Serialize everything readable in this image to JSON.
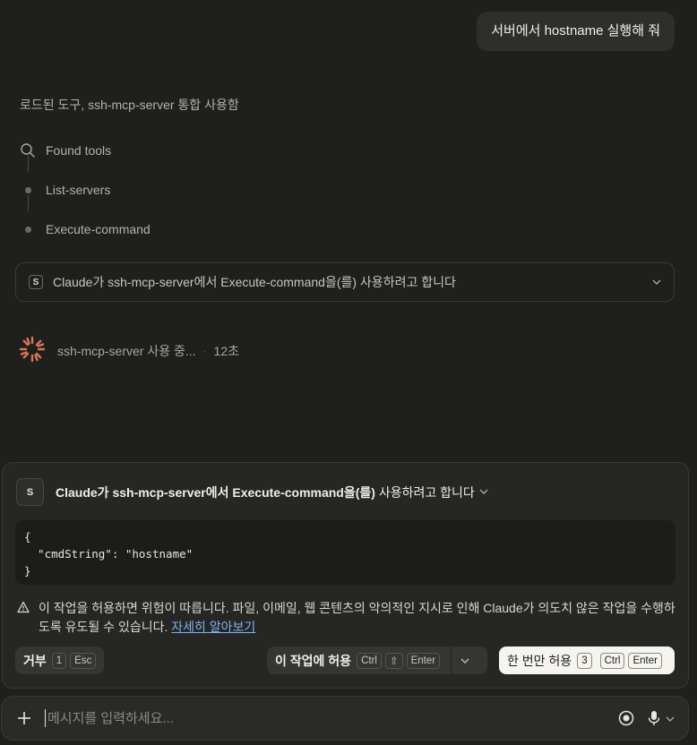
{
  "user_message": "서버에서 hostname 실행해 줘",
  "loaded_tools_text": "로드된 도구, ssh-mcp-server 통합 사용함",
  "steps": [
    {
      "label": "Found tools",
      "icon": "search-icon"
    },
    {
      "label": "List-servers",
      "icon": "dot-icon"
    },
    {
      "label": "Execute-command",
      "icon": "dot-icon"
    }
  ],
  "permission_collapsed": {
    "badge": "S",
    "text": "Claude가 ssh-mcp-server에서 Execute-command을(를) 사용하려고 합니다"
  },
  "working": {
    "label": "ssh-mcp-server 사용 중...",
    "separator": "·",
    "elapsed": "12초"
  },
  "permission_panel": {
    "badge": "S",
    "title_bold": "Claude가 ssh-mcp-server에서 Execute-command을(를)",
    "title_rest": " 사용하려고 합니다",
    "code": "{\n  \"cmdString\": \"hostname\"\n}",
    "warning_text": "이 작업을 허용하면 위험이 따릅니다. 파일, 이메일, 웹 콘텐츠의 악의적인 지시로 인해 Claude가 의도치 않은 작업을 수행하도록 유도될 수 있습니다. ",
    "learn_more": "자세히 알아보기",
    "deny": {
      "label": "거부",
      "key_num": "1",
      "key_esc": "Esc"
    },
    "allow_task": {
      "label": "이 작업에 허용",
      "key_ctrl": "Ctrl",
      "key_shift": "⇧",
      "key_enter": "Enter"
    },
    "allow_once": {
      "label": "한 번만 허용",
      "key_num": "3",
      "key_ctrl": "Ctrl",
      "key_enter": "Enter"
    }
  },
  "composer": {
    "placeholder": "메시지를 입력하세요..."
  },
  "colors": {
    "background": "#1f1f1e",
    "spinner": "#d97757",
    "link": "#7ab3ef"
  }
}
